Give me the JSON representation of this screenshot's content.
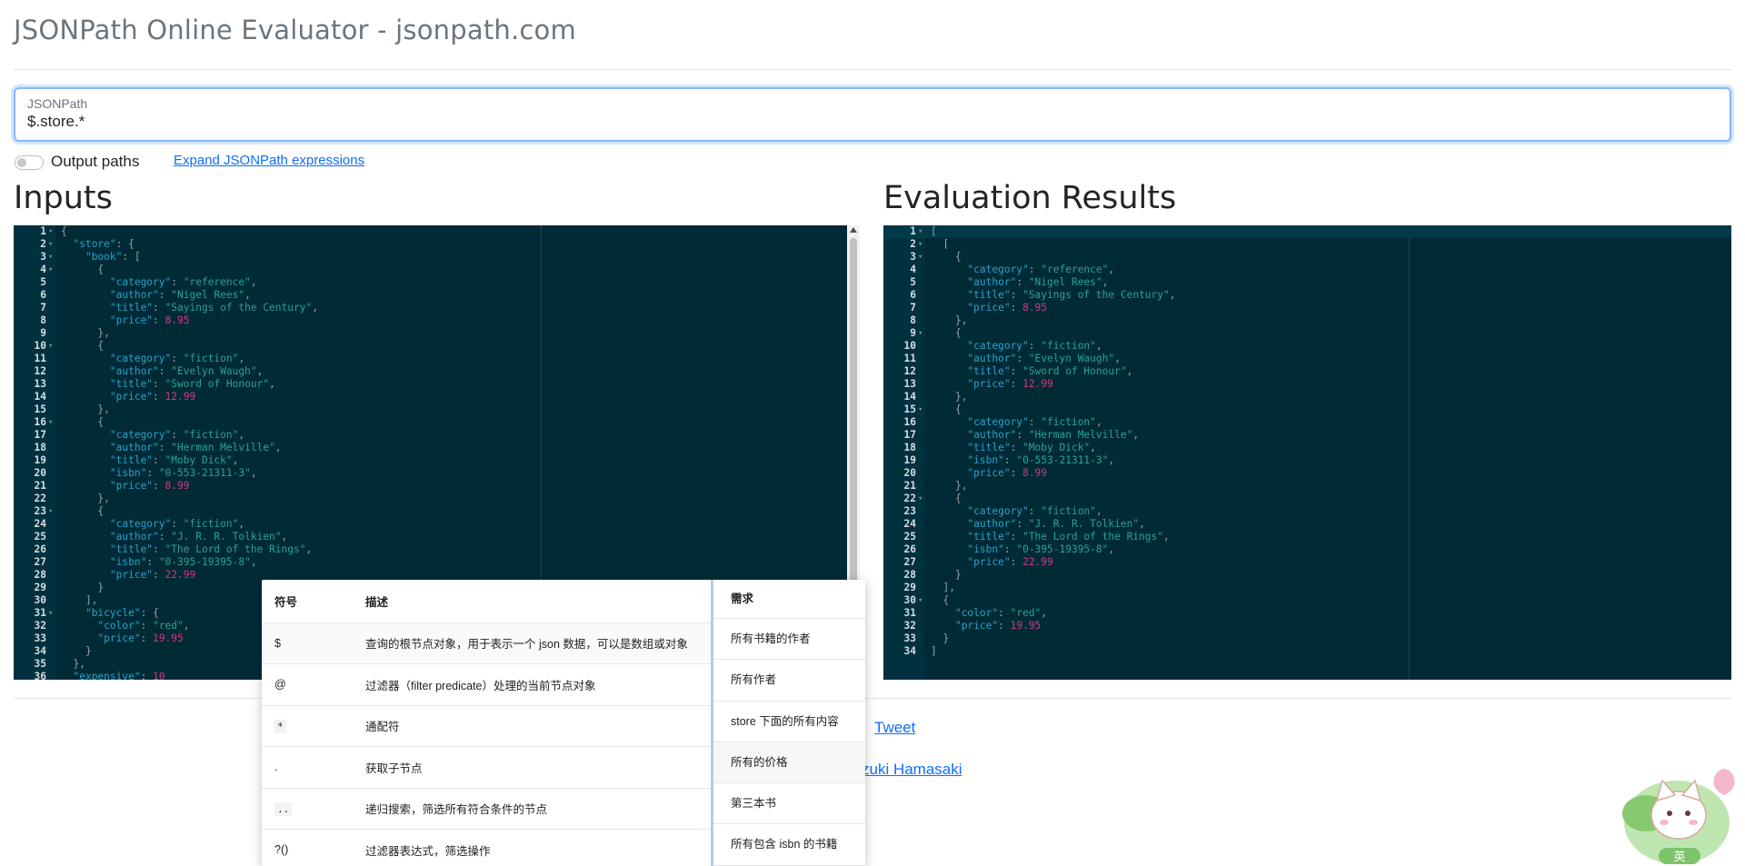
{
  "header": {
    "title": "JSONPath Online Evaluator - jsonpath.com"
  },
  "path_input": {
    "label": "JSONPath",
    "value": "$.store.*"
  },
  "options": {
    "output_paths_label": "Output paths",
    "output_paths_on": false,
    "expand_link": "Expand JSONPath expressions"
  },
  "inputs": {
    "title": "Inputs",
    "lines": [
      "{",
      "  \"store\": {",
      "    \"book\": [",
      "      {",
      "        \"category\": \"reference\",",
      "        \"author\": \"Nigel Rees\",",
      "        \"title\": \"Sayings of the Century\",",
      "        \"price\": 8.95",
      "      },",
      "      {",
      "        \"category\": \"fiction\",",
      "        \"author\": \"Evelyn Waugh\",",
      "        \"title\": \"Sword of Honour\",",
      "        \"price\": 12.99",
      "      },",
      "      {",
      "        \"category\": \"fiction\",",
      "        \"author\": \"Herman Melville\",",
      "        \"title\": \"Moby Dick\",",
      "        \"isbn\": \"0-553-21311-3\",",
      "        \"price\": 8.99",
      "      },",
      "      {",
      "        \"category\": \"fiction\",",
      "        \"author\": \"J. R. R. Tolkien\",",
      "        \"title\": \"The Lord of the Rings\",",
      "        \"isbn\": \"0-395-19395-8\",",
      "        \"price\": 22.99",
      "      }",
      "    ],",
      "    \"bicycle\": {",
      "      \"color\": \"red\",",
      "      \"price\": 19.95",
      "    }",
      "  },",
      "  \"expensive\": 10"
    ],
    "fold_lines": [
      1,
      2,
      3,
      4,
      10,
      16,
      23,
      31
    ]
  },
  "results": {
    "title": "Evaluation Results",
    "lines": [
      "[",
      "  [",
      "    {",
      "      \"category\": \"reference\",",
      "      \"author\": \"Nigel Rees\",",
      "      \"title\": \"Sayings of the Century\",",
      "      \"price\": 8.95",
      "    },",
      "    {",
      "      \"category\": \"fiction\",",
      "      \"author\": \"Evelyn Waugh\",",
      "      \"title\": \"Sword of Honour\",",
      "      \"price\": 12.99",
      "    },",
      "    {",
      "      \"category\": \"fiction\",",
      "      \"author\": \"Herman Melville\",",
      "      \"title\": \"Moby Dick\",",
      "      \"isbn\": \"0-553-21311-3\",",
      "      \"price\": 8.99",
      "    },",
      "    {",
      "      \"category\": \"fiction\",",
      "      \"author\": \"J. R. R. Tolkien\",",
      "      \"title\": \"The Lord of the Rings\",",
      "      \"isbn\": \"0-395-19395-8\",",
      "      \"price\": 22.99",
      "    }",
      "  ],",
      "  {",
      "    \"color\": \"red\",",
      "    \"price\": 19.95",
      "  }",
      "]"
    ],
    "fold_lines": [
      1,
      2,
      3,
      9,
      15,
      22,
      30
    ]
  },
  "footer": {
    "tweet": "Tweet",
    "author": "zuki Hamasaki"
  },
  "popup": {
    "headers": {
      "symbol": "符号",
      "description": "描述",
      "requirement": "需求"
    },
    "rows": [
      {
        "symbol": "$",
        "description": "查询的根节点对象，用于表示一个 json 数据，可以是数组或对象"
      },
      {
        "symbol": "@",
        "description": "过滤器（filter predicate）处理的当前节点对象"
      },
      {
        "symbol": "*",
        "description": "通配符"
      },
      {
        "symbol": ".",
        "description": "获取子节点"
      },
      {
        "symbol": "..",
        "description": "递归搜索，筛选所有符合条件的节点"
      },
      {
        "symbol": "?()",
        "description": "过滤器表达式，筛选操作"
      }
    ],
    "requirements": [
      "所有书籍的作者",
      "所有作者",
      "store 下面的所有内容",
      "所有的价格",
      "第三本书",
      "所有包含 isbn 的书籍"
    ]
  },
  "mascot": {
    "badge": "英"
  },
  "colors": {
    "editor_bg": "#002b36",
    "key": "#2aa1ca",
    "string": "#2aa198",
    "number": "#d33682",
    "link": "#0d6efd"
  }
}
